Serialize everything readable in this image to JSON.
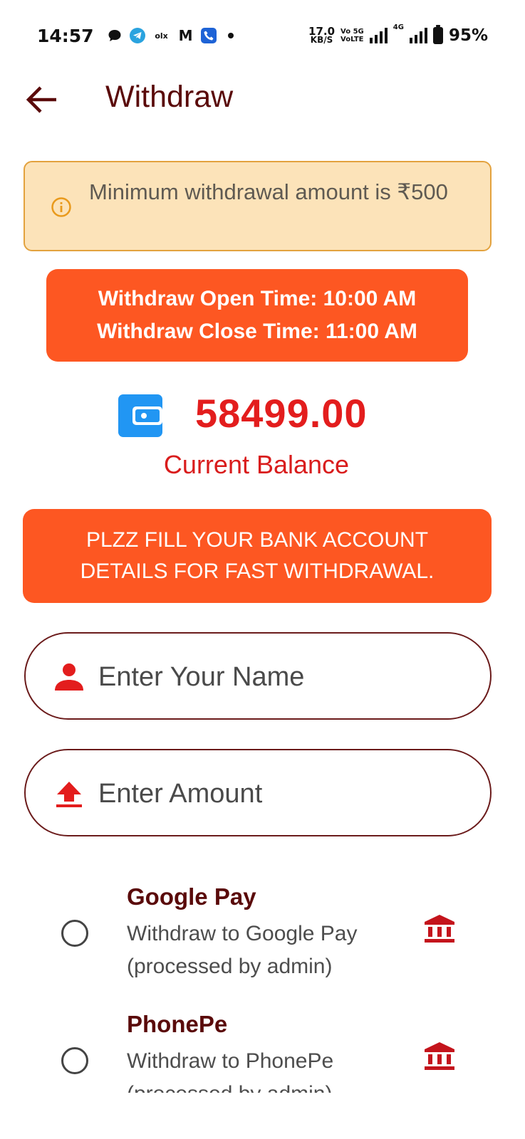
{
  "status_bar": {
    "time": "14:57",
    "olx_label": "olx",
    "gmail_label": "M",
    "speed_value": "17.0",
    "speed_unit": "KB/S",
    "volte_line1": "Vo 5G",
    "volte_line2": "VoLTE",
    "net_label": "4G",
    "battery": "95%"
  },
  "app_bar": {
    "title": "Withdraw"
  },
  "notice": {
    "text": "Minimum withdrawal amount is ₹500"
  },
  "time_banner": {
    "open": "Withdraw Open Time: 10:00 AM",
    "close": "Withdraw Close Time: 11:00 AM"
  },
  "balance": {
    "amount": "58499.00",
    "label": "Current Balance"
  },
  "bank_banner": {
    "line1": "PLZZ FILL YOUR BANK ACCOUNT",
    "line2": "DETAILS FOR FAST WITHDRAWAL."
  },
  "form": {
    "name_placeholder": "Enter Your Name",
    "amount_placeholder": "Enter Amount"
  },
  "payment_options": [
    {
      "title": "Google Pay",
      "description": "Withdraw to Google Pay (processed by admin)"
    },
    {
      "title": "PhonePe",
      "description": "Withdraw to PhonePe (processed by admin)"
    }
  ],
  "colors": {
    "accent_orange": "#fd5722",
    "title_maroon": "#5a0a0a",
    "balance_red": "#e31d1d",
    "notice_bg": "#fce3b9",
    "notice_border": "#e3a23e",
    "wallet_blue": "#2196f3"
  },
  "icons": {
    "back": "arrow-left-icon",
    "info": "info-circle-icon",
    "wallet": "wallet-icon",
    "person": "person-icon",
    "upload": "upload-arrow-icon",
    "bank": "bank-icon"
  }
}
